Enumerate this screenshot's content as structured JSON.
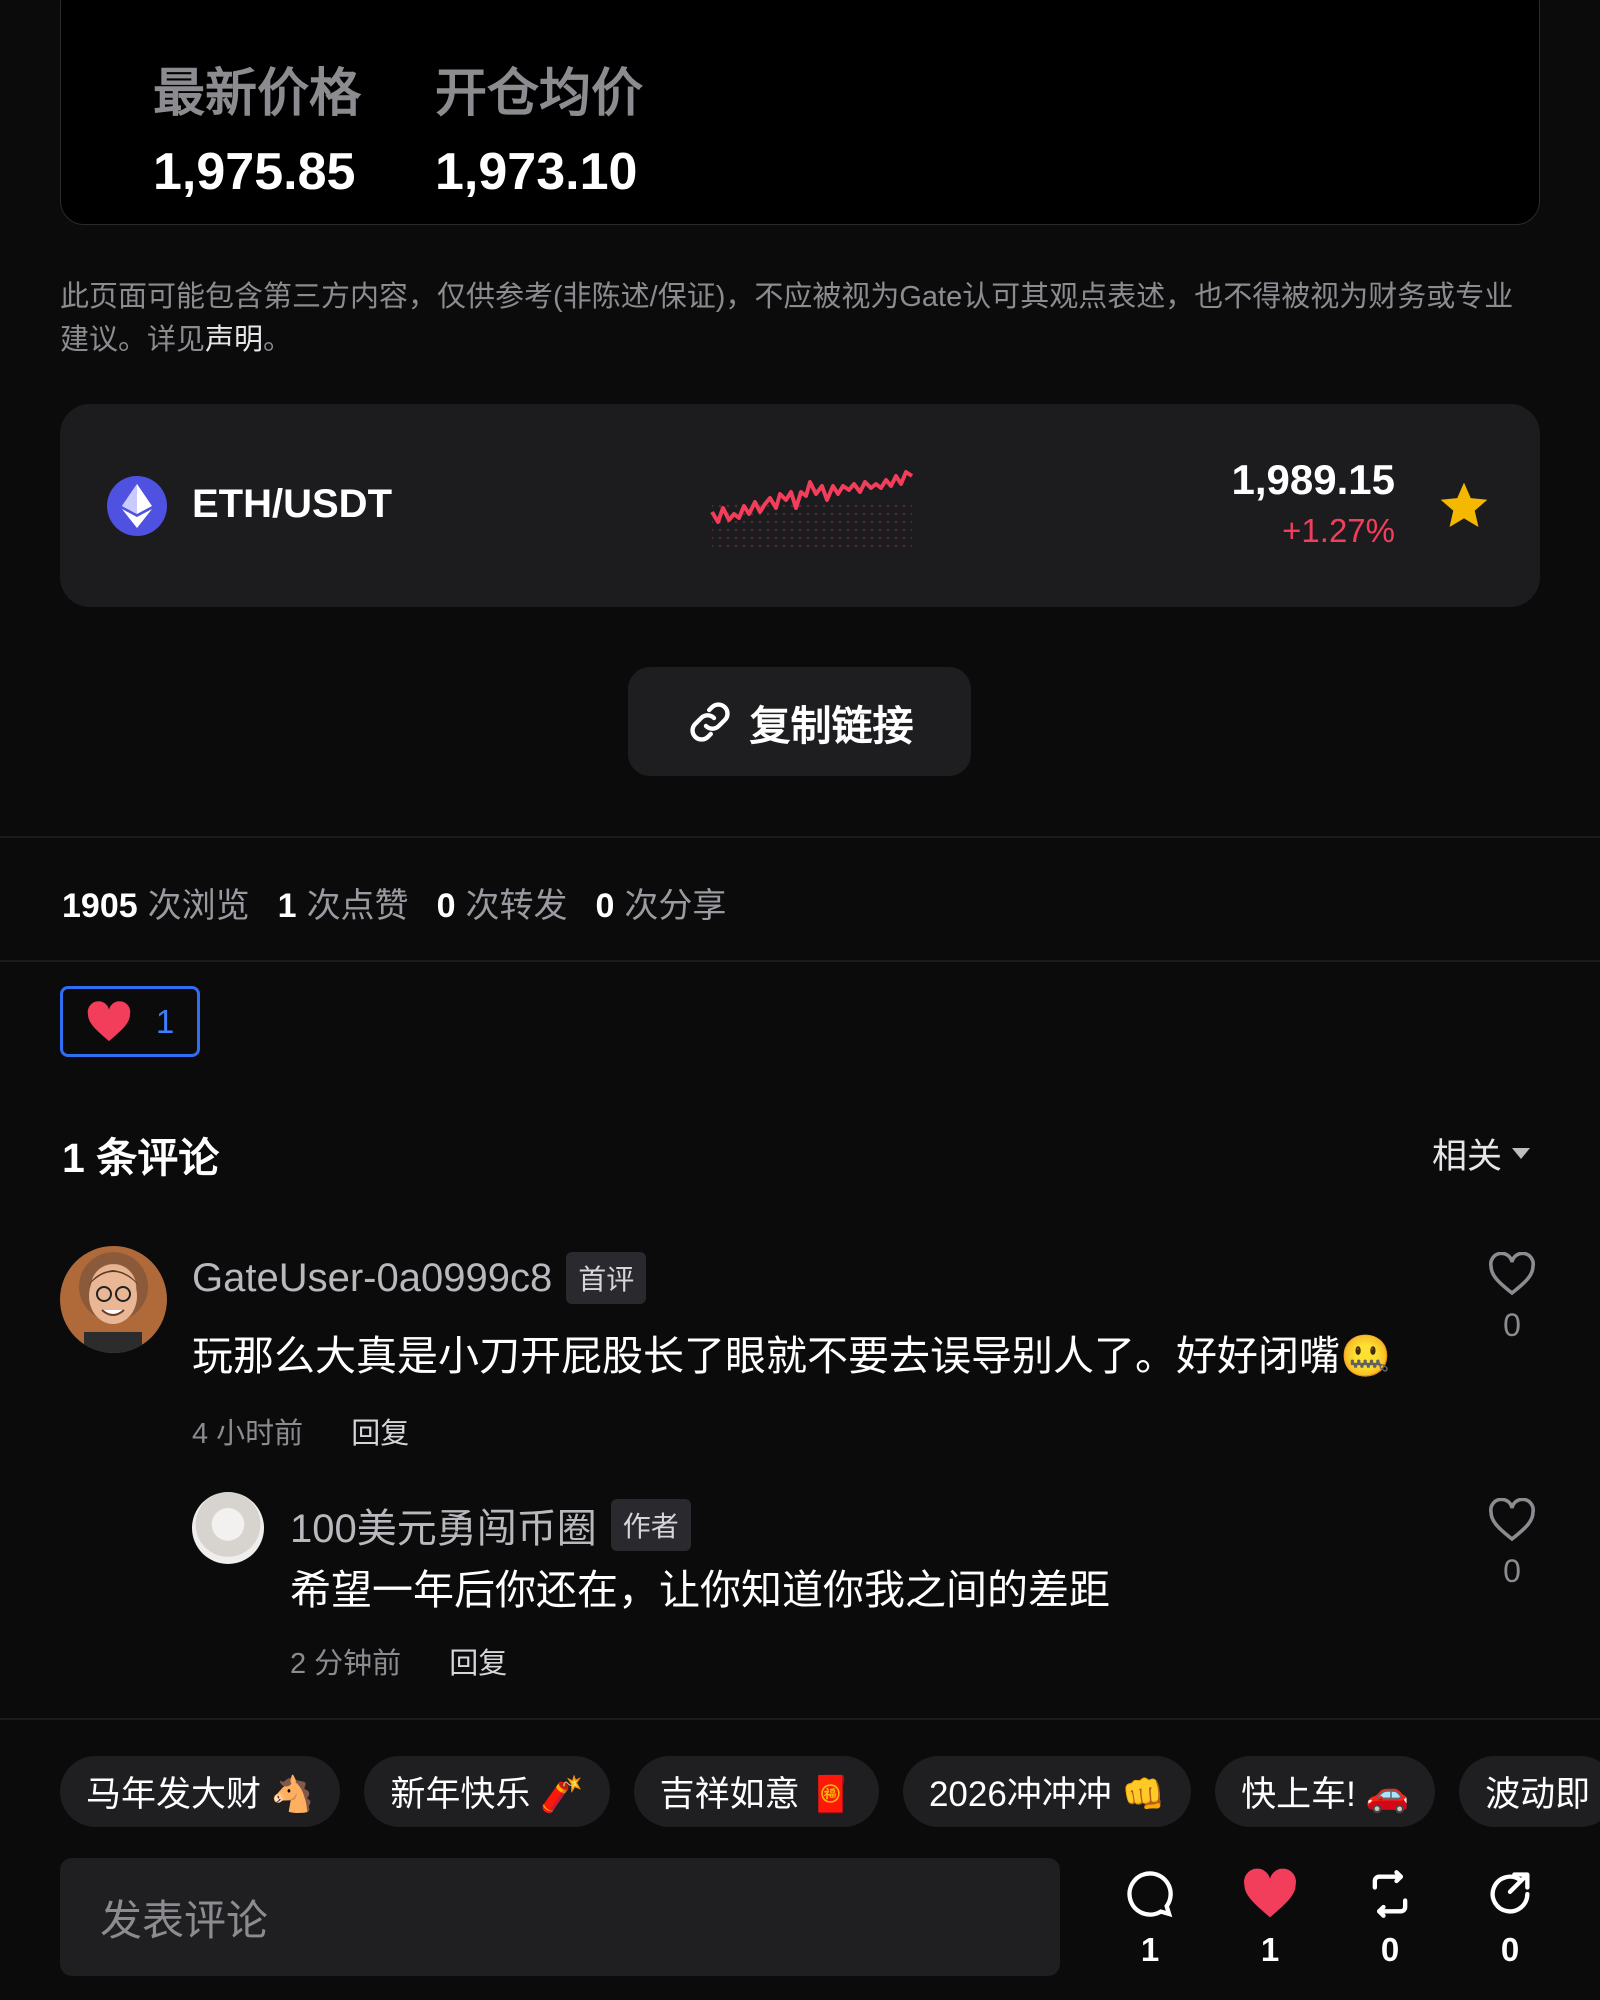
{
  "position": {
    "latest_price_label": "最新价格",
    "avg_open_label": "开仓均价",
    "latest_price": "1,975.85",
    "avg_open": "1,973.10"
  },
  "disclaimer": {
    "text": "此页面可能包含第三方内容，仅供参考(非陈述/保证)，不应被视为Gate认可其观点表述，也不得被视为财务或专业建议。详见",
    "link": "声明",
    "end": "。"
  },
  "ticker": {
    "pair": "ETH/USDT",
    "price": "1,989.15",
    "change": "+1.27%",
    "icon": "eth-icon",
    "accent": "#f23d5b"
  },
  "copy_link": {
    "label": "复制链接"
  },
  "stats": [
    {
      "n": "1905",
      "u": "次浏览"
    },
    {
      "n": "1",
      "u": "次点赞"
    },
    {
      "n": "0",
      "u": "次转发"
    },
    {
      "n": "0",
      "u": "次分享"
    }
  ],
  "like_chip": {
    "count": "1"
  },
  "comments": {
    "title": "1 条评论",
    "sort": "相关",
    "items": [
      {
        "user": "GateUser-0a0999c8",
        "tag": "首评",
        "text": "玩那么大真是小刀开屁股长了眼就不要去误导别人了。好好闭嘴🤐",
        "time": "4 小时前",
        "reply": "回复",
        "likes": "0"
      },
      {
        "user": "100美元勇闯币圈",
        "tag": "作者",
        "text": "希望一年后你还在，让你知道你我之间的差距",
        "time": "2 分钟前",
        "reply": "回复",
        "likes": "0"
      }
    ]
  },
  "quick_chips": [
    "马年发大财 🐴",
    "新年快乐 🧨",
    "吉祥如意 🧧",
    "2026冲冲冲 👊",
    "快上车! 🚗",
    "波动即"
  ],
  "composer": {
    "placeholder": "发表评论"
  },
  "actions": {
    "comment": "1",
    "like": "1",
    "repost": "0",
    "share": "0"
  }
}
